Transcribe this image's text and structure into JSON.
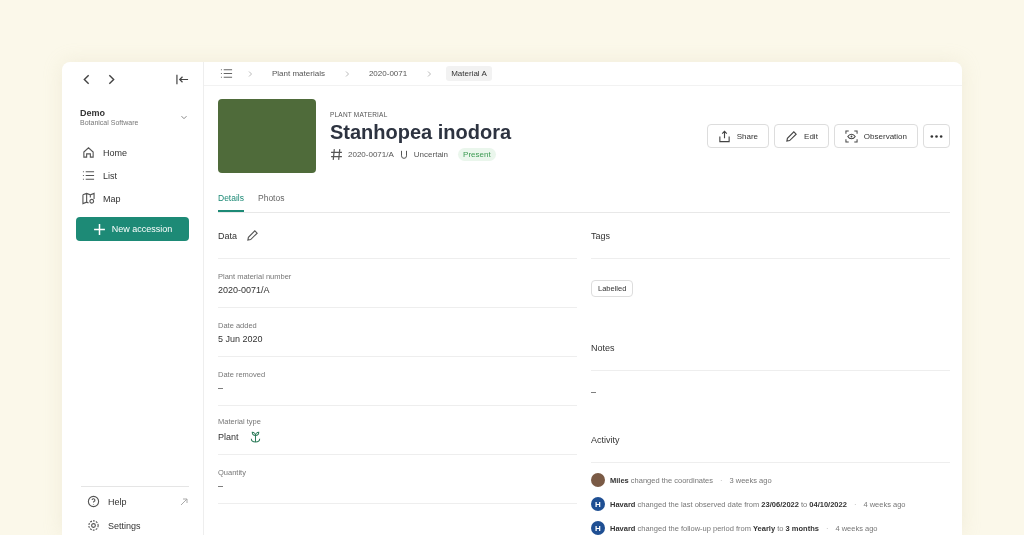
{
  "sidebar": {
    "workspace": {
      "name": "Demo",
      "subtitle": "Botanical Software"
    },
    "nav": [
      {
        "label": "Home"
      },
      {
        "label": "List"
      },
      {
        "label": "Map"
      }
    ],
    "primary_button": "New accession",
    "footer": [
      {
        "label": "Help",
        "external": true
      },
      {
        "label": "Settings",
        "external": false
      }
    ]
  },
  "breadcrumb": [
    {
      "label": "Plant materials",
      "selected": false
    },
    {
      "label": "2020-0071",
      "selected": false
    },
    {
      "label": "Material A",
      "selected": true
    }
  ],
  "header": {
    "overline": "PLANT MATERIAL",
    "title": "Stanhopea inodora",
    "number": "2020-0071/A",
    "certainty": "Uncertain",
    "status": "Present"
  },
  "actions": [
    {
      "label": "Share"
    },
    {
      "label": "Edit"
    },
    {
      "label": "Observation"
    }
  ],
  "tabs": [
    {
      "label": "Details",
      "selected": true
    },
    {
      "label": "Photos",
      "selected": false
    }
  ],
  "data_section": {
    "title": "Data",
    "fields": [
      {
        "label": "Plant material number",
        "value": "2020-0071/A",
        "plant_icon": false
      },
      {
        "label": "Date added",
        "value": "5 Jun 2020",
        "plant_icon": false
      },
      {
        "label": "Date removed",
        "value": "–",
        "plant_icon": false
      },
      {
        "label": "Material type",
        "value": "Plant",
        "plant_icon": true
      },
      {
        "label": "Quantity",
        "value": "–",
        "plant_icon": false
      }
    ]
  },
  "tags": {
    "title": "Tags",
    "items": [
      "Labelled"
    ]
  },
  "notes": {
    "title": "Notes",
    "value": "–"
  },
  "activity": {
    "title": "Activity",
    "items": [
      {
        "text": "**Miles** changed the coordinates",
        "separator": "·",
        "time": "3 weeks ago"
      },
      {
        "initial": "H",
        "text": "**Havard** changed the last observed date from **23/06/2022** to **04/10/2022**",
        "separator": "·",
        "time": "4 weeks ago"
      },
      {
        "initial": "H",
        "text": "**Havard** changed the follow-up period from **Yearly** to **3 months**",
        "separator": "·",
        "time": "4 weeks ago"
      }
    ]
  }
}
